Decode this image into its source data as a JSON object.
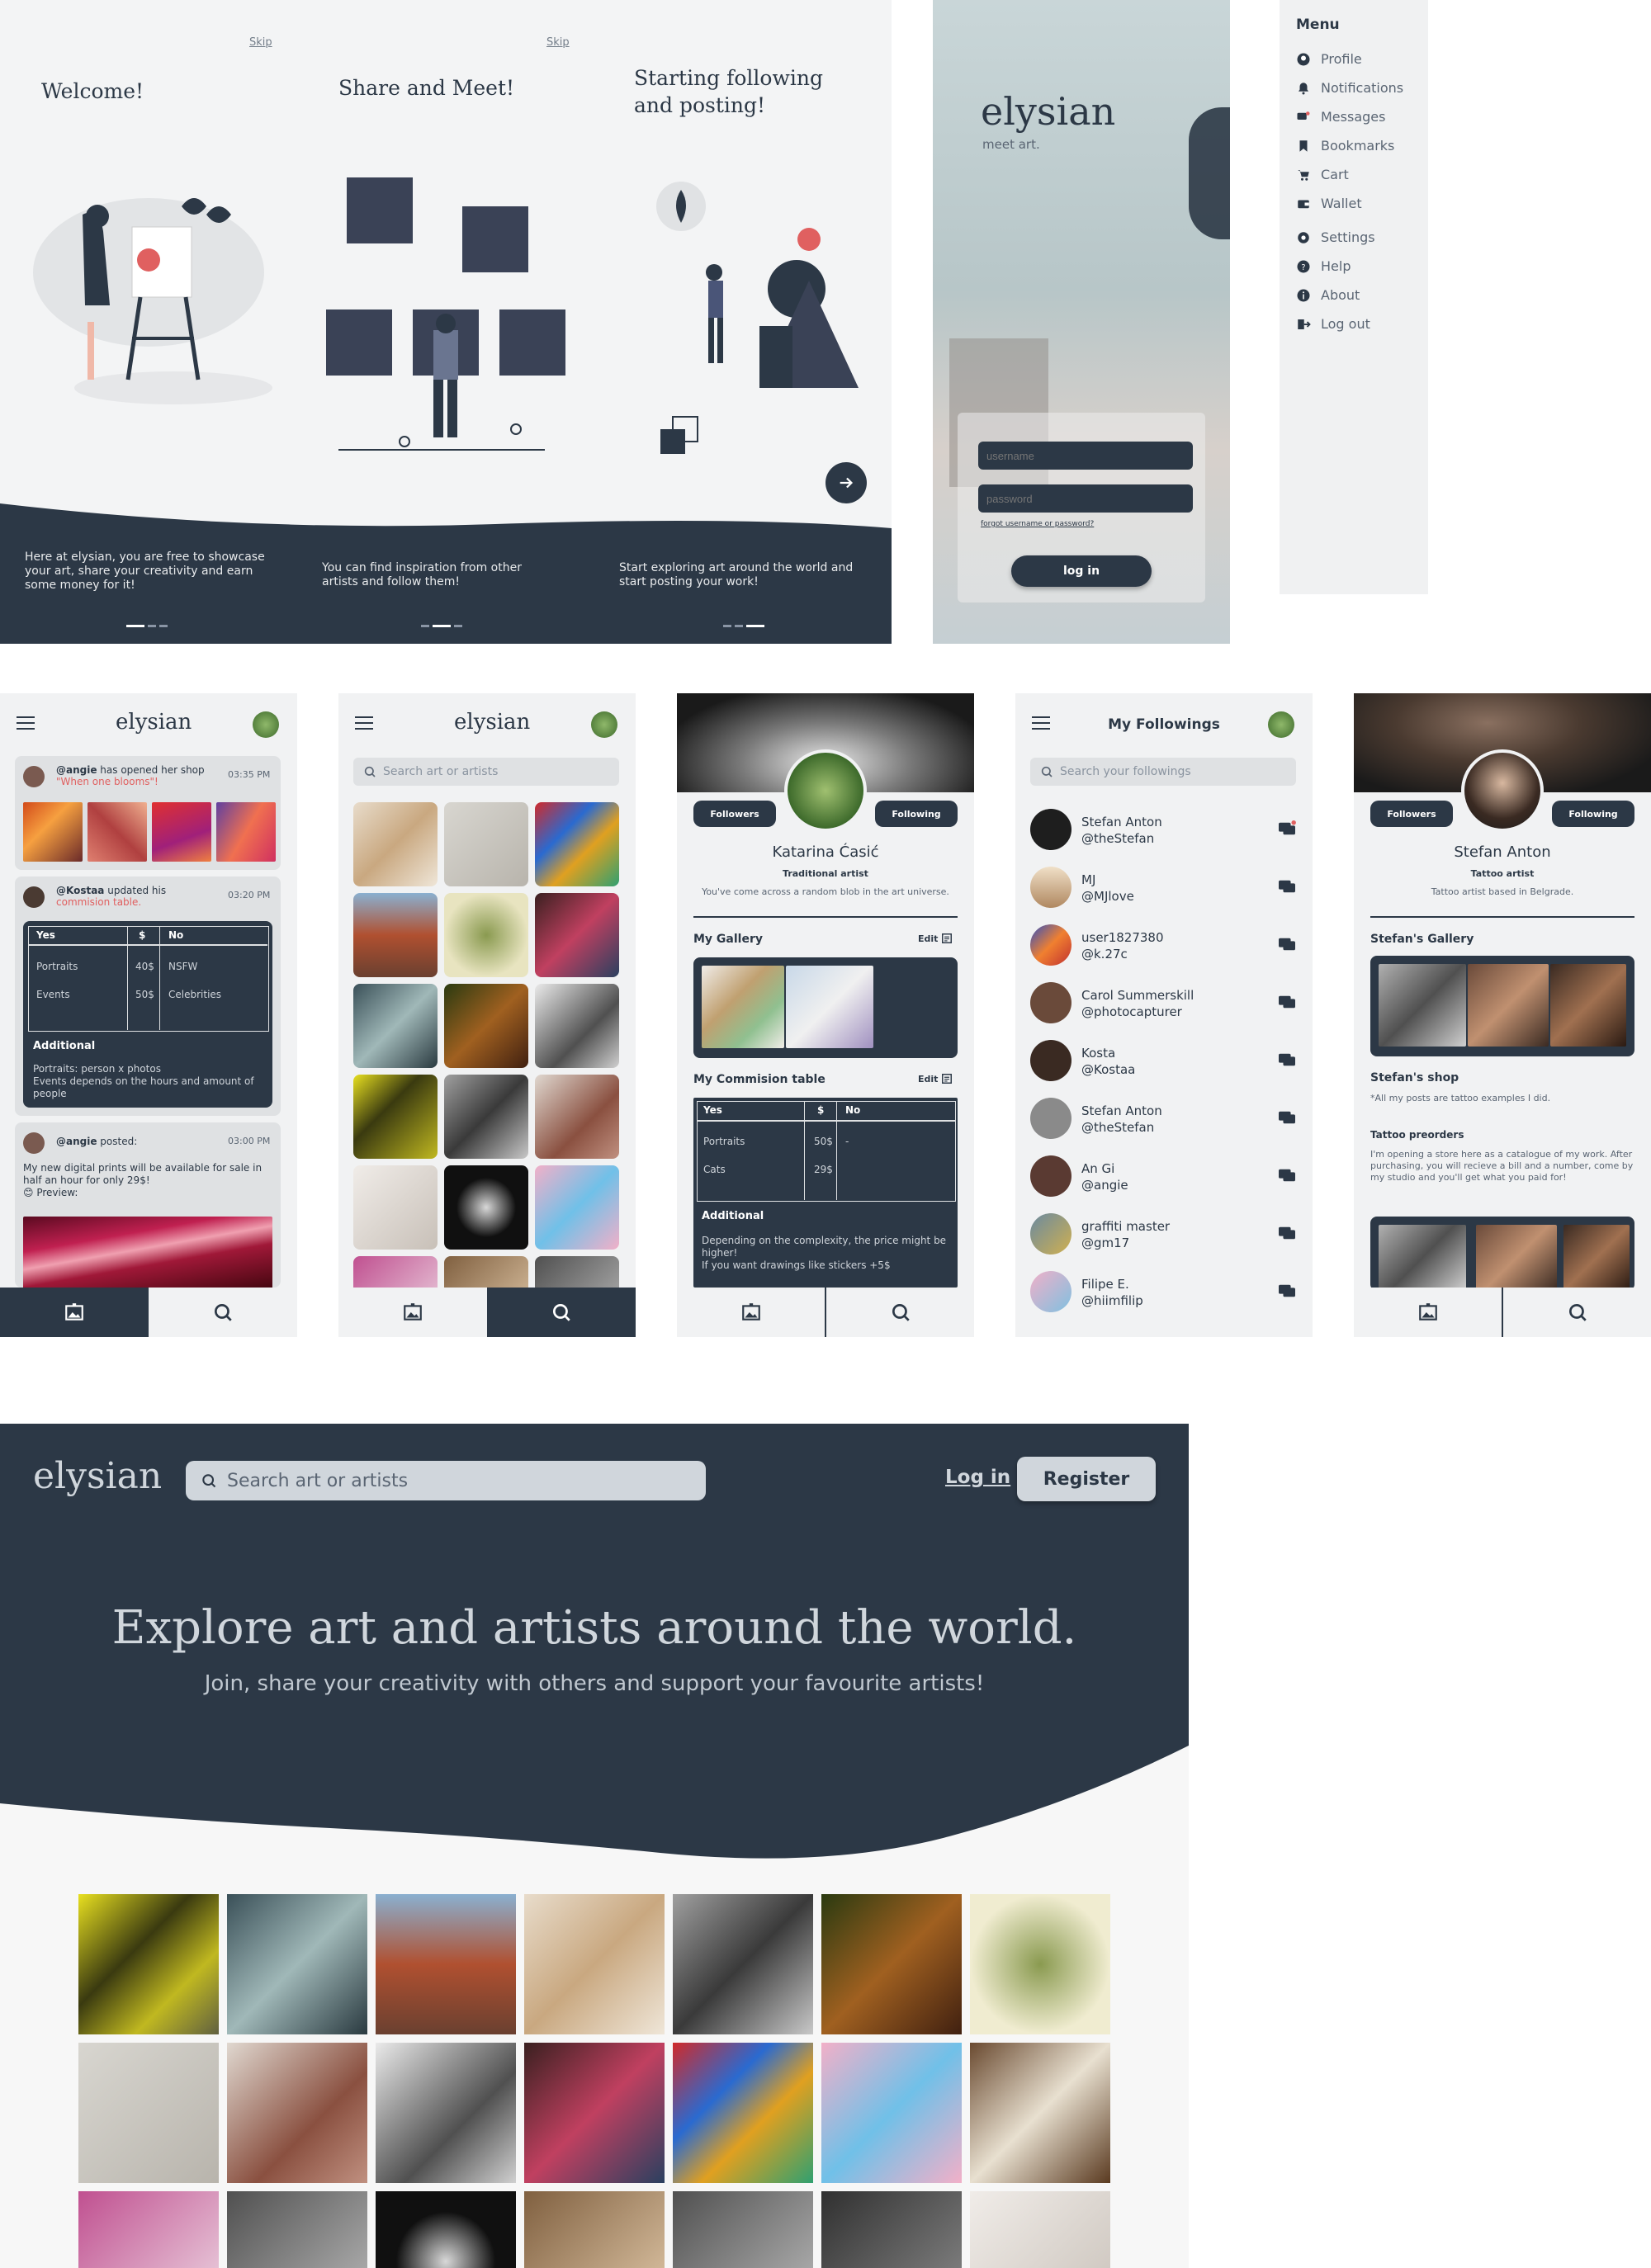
{
  "colors": {
    "navy": "#2c3846",
    "bg": "#f1f2f3",
    "muted": "#737d89",
    "accent": "#e06060"
  },
  "onboarding": [
    {
      "skip": "Skip",
      "title": "Welcome!",
      "text": "Here at elysian, you are free to showcase your art, share your creativity and earn some money for it!"
    },
    {
      "skip": "Skip",
      "title": "Share and Meet!",
      "text": "You can find inspiration from other artists and follow them!"
    },
    {
      "skip": "",
      "title": "Starting following and posting!",
      "text": "Start exploring art around the world and start posting your work!"
    }
  ],
  "login": {
    "brand": "elysian",
    "tagline": "meet art.",
    "username_ph": "username",
    "password_ph": "password",
    "forgot": "forgot username or password?",
    "button": "log in"
  },
  "menu": {
    "title": "Menu",
    "items": [
      {
        "label": "Profile",
        "icon": "user-icon"
      },
      {
        "label": "Notifications",
        "icon": "bell-icon"
      },
      {
        "label": "Messages",
        "icon": "chat-icon"
      },
      {
        "label": "Bookmarks",
        "icon": "bookmark-icon"
      },
      {
        "label": "Cart",
        "icon": "cart-icon"
      },
      {
        "label": "Wallet",
        "icon": "wallet-icon"
      },
      {
        "label": "Settings",
        "icon": "gear-icon"
      },
      {
        "label": "Help",
        "icon": "help-icon"
      },
      {
        "label": "About",
        "icon": "info-icon"
      },
      {
        "label": "Log out",
        "icon": "logout-icon"
      }
    ]
  },
  "feed": {
    "brand": "elysian",
    "post1": {
      "user": "@angie",
      "text": " has opened her shop",
      "quote": "\"When one blooms\"!",
      "time": "03:35 PM"
    },
    "post2": {
      "user": "@Kostaa",
      "text": " updated his",
      "link": "commision table.",
      "time": "03:20 PM",
      "headers": [
        "Yes",
        "$",
        "No"
      ],
      "rows": [
        [
          "Portraits",
          "40$",
          "NSFW"
        ],
        [
          "Events",
          "50$",
          "Celebrities"
        ]
      ],
      "additional_title": "Additional",
      "additional_text": "Portraits: person x photos\nEvents depends on the hours and amount of people"
    },
    "post3": {
      "user": "@angie",
      "text": " posted:",
      "time": "03:00 PM",
      "body": "My new digital prints will be available for sale in half an hour for only 29$!\n😊 Preview:"
    }
  },
  "explore": {
    "brand": "elysian",
    "search_ph": "Search art or artists"
  },
  "profile1": {
    "followers": "Followers",
    "following": "Following",
    "name": "Katarina Ćasić",
    "role": "Traditional artist",
    "bio": "You've come across a random blob in the art universe.",
    "gallery_title": "My Gallery",
    "edit": "Edit",
    "table_title": "My Commision table",
    "headers": [
      "Yes",
      "$",
      "No"
    ],
    "rows": [
      [
        "Portraits",
        "50$",
        "-"
      ],
      [
        "Cats",
        "29$",
        ""
      ]
    ],
    "additional_title": "Additional",
    "additional_text": "Depending on the complexity, the price might be higher!\nIf you want drawings like stickers +5$"
  },
  "followings": {
    "title": "My Followings",
    "search_ph": "Search your followings",
    "people": [
      {
        "name": "Stefan Anton",
        "handle": "@theStefan"
      },
      {
        "name": "MJ",
        "handle": "@MJlove"
      },
      {
        "name": "user1827380",
        "handle": "@k.27c"
      },
      {
        "name": "Carol Summerskill",
        "handle": "@photocapturer"
      },
      {
        "name": "Kosta",
        "handle": "@Kostaa"
      },
      {
        "name": "Stefan Anton",
        "handle": "@theStefan"
      },
      {
        "name": "An Gi",
        "handle": "@angie"
      },
      {
        "name": "graffiti master",
        "handle": "@gm17"
      },
      {
        "name": "Filipe E.",
        "handle": "@hiimfilip"
      }
    ]
  },
  "profile2": {
    "followers": "Followers",
    "following": "Following",
    "name": "Stefan Anton",
    "role": "Tattoo artist",
    "bio": "Tattoo artist based in Belgrade.",
    "gallery_title": "Stefan's Gallery",
    "shop_title": "Stefan's shop",
    "shop_note": "*All my posts are tattoo examples I did.",
    "preorder_title": "Tattoo preorders",
    "preorder_text": "I'm opening a store here as a catalogue of my work. After purchasing, you will recieve a bill and a number, come by my studio and you'll get what you paid for!"
  },
  "web": {
    "brand": "elysian",
    "search_ph": "Search art or artists",
    "login": "Log in",
    "register": "Register",
    "headline": "Explore art and artists around the world.",
    "subhead": "Join, share your creativity with others and support your favourite artists!"
  }
}
